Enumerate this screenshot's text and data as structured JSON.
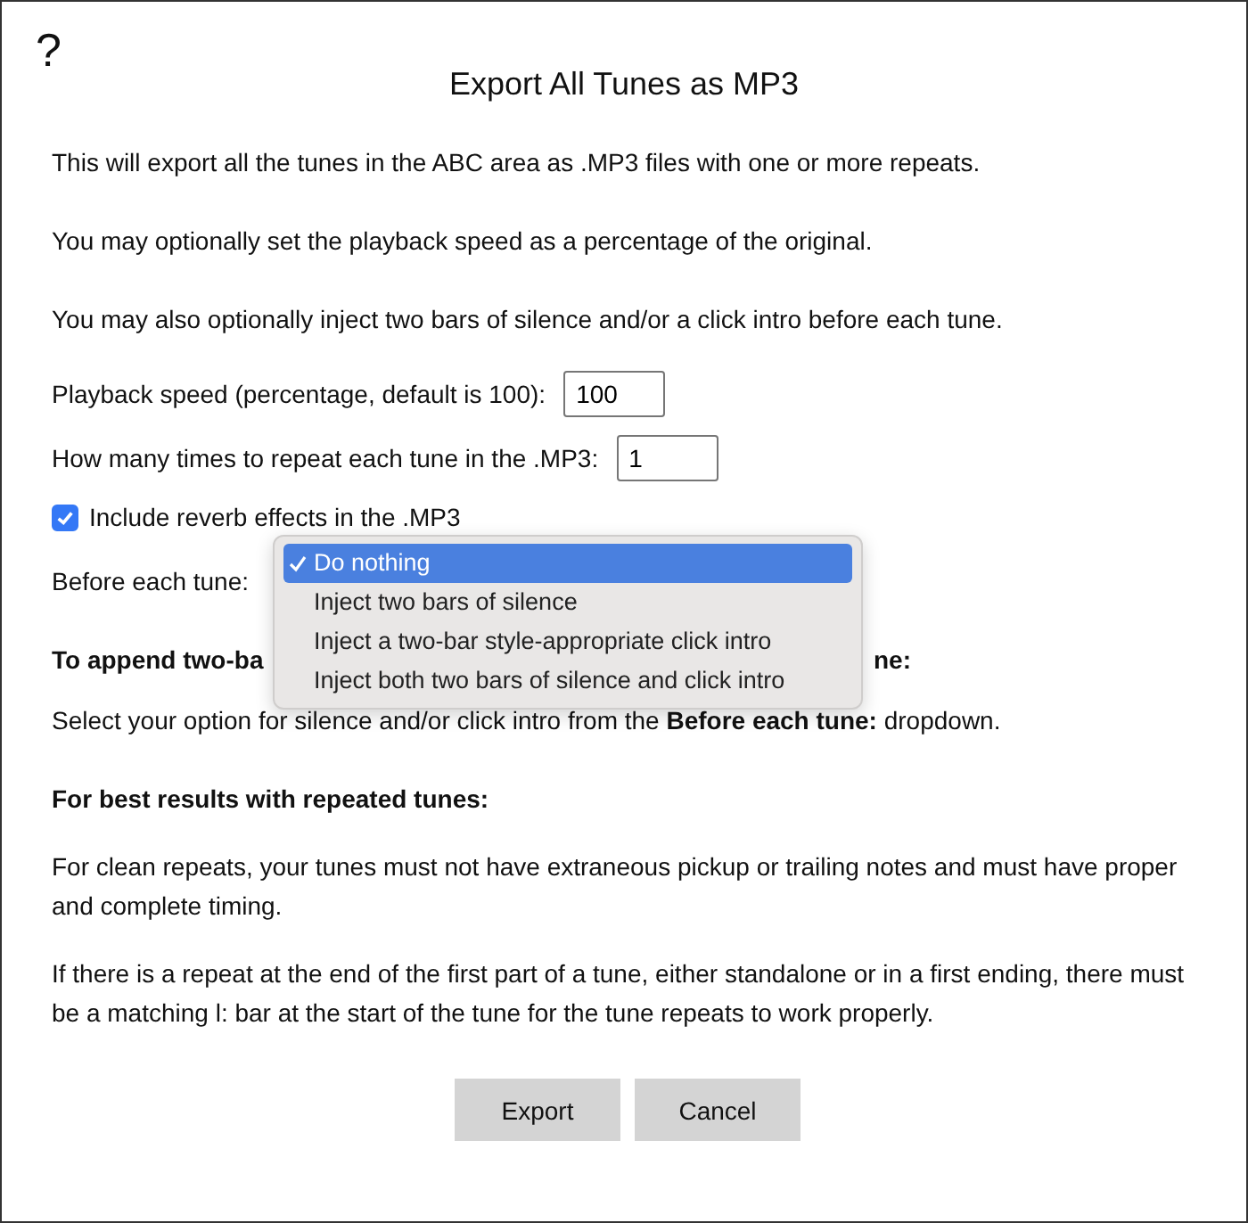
{
  "help_icon": "?",
  "title": "Export All Tunes as MP3",
  "intro": [
    "This will export all the tunes in the ABC area as .MP3 files with one or more repeats.",
    "You may optionally set the playback speed as a percentage of the original.",
    "You may also optionally inject two bars of silence and/or a click intro before each tune."
  ],
  "fields": [
    {
      "label": "Playback speed (percentage, default is 100):",
      "value": "100"
    },
    {
      "label": "How many times to repeat each tune in the .MP3:",
      "value": "1"
    }
  ],
  "reverb": {
    "label": "Include reverb effects in the .MP3",
    "checked": true
  },
  "before_each_tune": {
    "label": "Before each tune:",
    "options": [
      {
        "label": "Do nothing",
        "selected": true
      },
      {
        "label": "Inject two bars of silence",
        "selected": false
      },
      {
        "label": "Inject a two-bar style-appropriate click intro",
        "selected": false
      },
      {
        "label": "Inject both two bars of silence and click intro",
        "selected": false
      }
    ]
  },
  "append_heading": {
    "start": "To append two-ba",
    "end": "ne:"
  },
  "select_note": "Select your option for silence and/or click intro from the **Before each tune:** dropdown.",
  "best_heading": "For best results with repeated tunes:",
  "notes": [
    "For clean repeats, your tunes must not have extraneous pickup or trailing notes and must have proper and complete timing.",
    "If there is a repeat at the end of the first part of a tune, either standalone or in a first ending, there must be a matching l: bar at the start of the tune for the tune repeats to work properly."
  ],
  "buttons": [
    "Export",
    "Cancel"
  ]
}
